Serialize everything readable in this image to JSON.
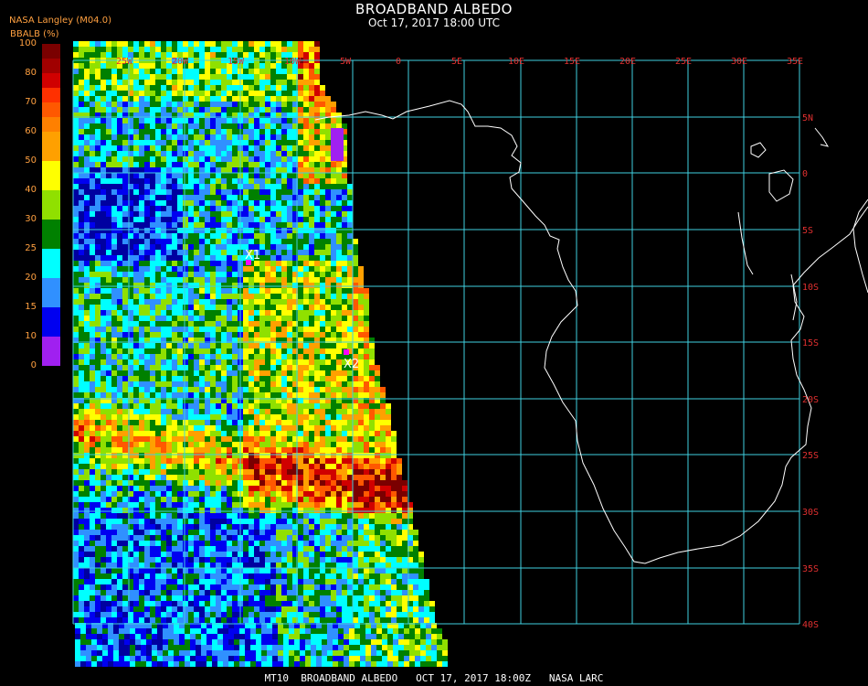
{
  "header": {
    "source": "NASA Langley (M04.0)",
    "title": "BROADBAND ALBEDO",
    "datetime": "Oct 17, 2017 18:00 UTC"
  },
  "colorbar": {
    "units_label": "BBALB (%)",
    "ticks": [
      "100",
      "80",
      "70",
      "60",
      "50",
      "40",
      "30",
      "25",
      "20",
      "15",
      "10",
      "0"
    ],
    "colors": [
      "#7a0000",
      "#a00000",
      "#d00000",
      "#ff3000",
      "#ff7000",
      "#ffa000",
      "#ffff00",
      "#b8ff00",
      "#6cd000",
      "#008000",
      "#00ffff",
      "#3090ff",
      "#0000f0",
      "#0000a0",
      "#a020f0"
    ]
  },
  "grid": {
    "longitude_labels": [
      "25W",
      "20W",
      "15W",
      "10W",
      "5W",
      "0",
      "5E",
      "10E",
      "15E",
      "20E",
      "25E",
      "30E",
      "35E"
    ],
    "latitude_labels": [
      "5N",
      "0",
      "5S",
      "10S",
      "15S",
      "20S",
      "25S",
      "30S",
      "35S",
      "40S"
    ],
    "grid_color": "#40d0e0",
    "label_color": "#e03030"
  },
  "markers": [
    {
      "label": "X1",
      "color": "#ff00ff"
    },
    {
      "label": "X2",
      "color": "#ff00ff"
    }
  ],
  "footer": {
    "text": "MT10  BROADBAND ALBEDO   OCT 17, 2017 18:00Z   NASA LARC"
  }
}
